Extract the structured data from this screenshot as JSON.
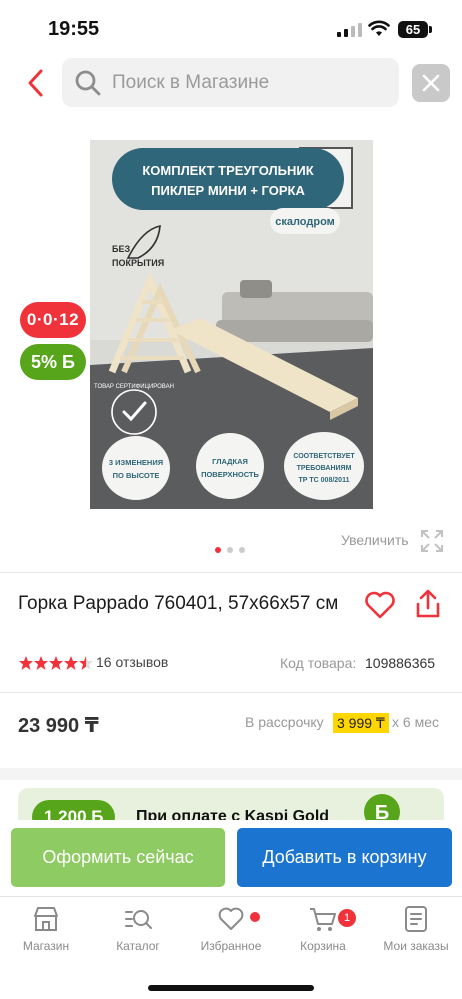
{
  "status_bar": {
    "time": "19:55",
    "battery": "65"
  },
  "search": {
    "placeholder": "Поиск в Магазине"
  },
  "product_image": {
    "banner_line1": "КОМПЛЕКТ ТРЕУГОЛЬНИК",
    "banner_line2": "ПИКЛЕР МИНИ + ГОРКА",
    "tag_climb": "скалодром",
    "tag_uncoated_1": "БЕЗ",
    "tag_uncoated_2": "ПОКРЫТИЯ",
    "seal_text": "ТОВАР СЕРТИФИЦИРОВАН",
    "feature1_line1": "3 ИЗМЕНЕНИЯ",
    "feature1_line2": "ПО ВЫСОТЕ",
    "feature2_line1": "ГЛАДКАЯ",
    "feature2_line2": "ПОВЕРХНОСТЬ",
    "feature3_line1": "СООТВЕТСТВУЕТ",
    "feature3_line2": "ТРЕБОВАНИЯМ",
    "feature3_line3": "ТР ТС 008/2011"
  },
  "badges": {
    "promo": "0·0·12",
    "bonus": "5% Б"
  },
  "gallery": {
    "total": 3,
    "active": 1,
    "zoom_label": "Увеличить"
  },
  "product": {
    "title": "Горка Pappado 760401, 57х66х57 см",
    "rating": 4.5,
    "reviews": "16 отзывов",
    "sku_label": "Код товара:",
    "sku": "109886365",
    "price": "23 990 ₸",
    "installment_label": "В рассрочку",
    "installment_amount": "3 999 ₸",
    "installment_months": "x 6 мес"
  },
  "promo": {
    "amount": "1 200 Б",
    "text": "При оплате с Kaspi Gold"
  },
  "actions": {
    "buy_now": "Оформить сейчас",
    "add_to_cart": "Добавить в корзину"
  },
  "tabs": [
    {
      "label": "Магазин"
    },
    {
      "label": "Каталог"
    },
    {
      "label": "Избранное"
    },
    {
      "label": "Корзина",
      "badge": "1"
    },
    {
      "label": "Мои заказы"
    }
  ],
  "colors": {
    "accent_red": "#f0333b",
    "green": "#57a51a",
    "blue": "#1b74d0",
    "yellow": "#ffd600"
  }
}
